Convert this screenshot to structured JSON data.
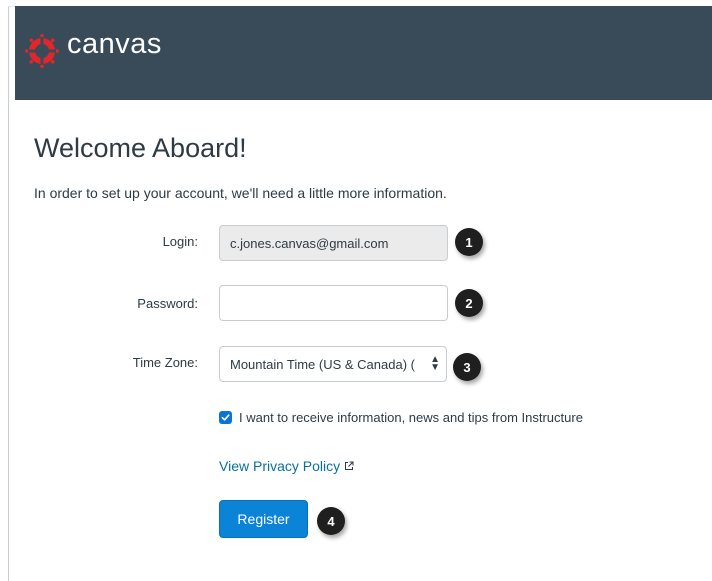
{
  "header": {
    "logo_text": "canvas",
    "logo_icon": "canvas-logo-icon",
    "background": "#394b58"
  },
  "page": {
    "title": "Welcome Aboard!",
    "intro": "In order to set up your account, we'll need a little more information."
  },
  "form": {
    "login_label": "Login:",
    "login_value": "c.jones.canvas@gmail.com",
    "password_label": "Password:",
    "password_value": "",
    "timezone_label": "Time Zone:",
    "timezone_value": "Mountain Time (US & Canada) (",
    "newsletter_checked": true,
    "newsletter_label": "I want to receive information, news and tips from Instructure",
    "privacy_link": "View Privacy Policy",
    "register_label": "Register"
  },
  "callouts": [
    "1",
    "2",
    "3",
    "4"
  ],
  "colors": {
    "accent": "#0b84d8",
    "link": "#0770a3",
    "callout": "#1f1f1f"
  }
}
